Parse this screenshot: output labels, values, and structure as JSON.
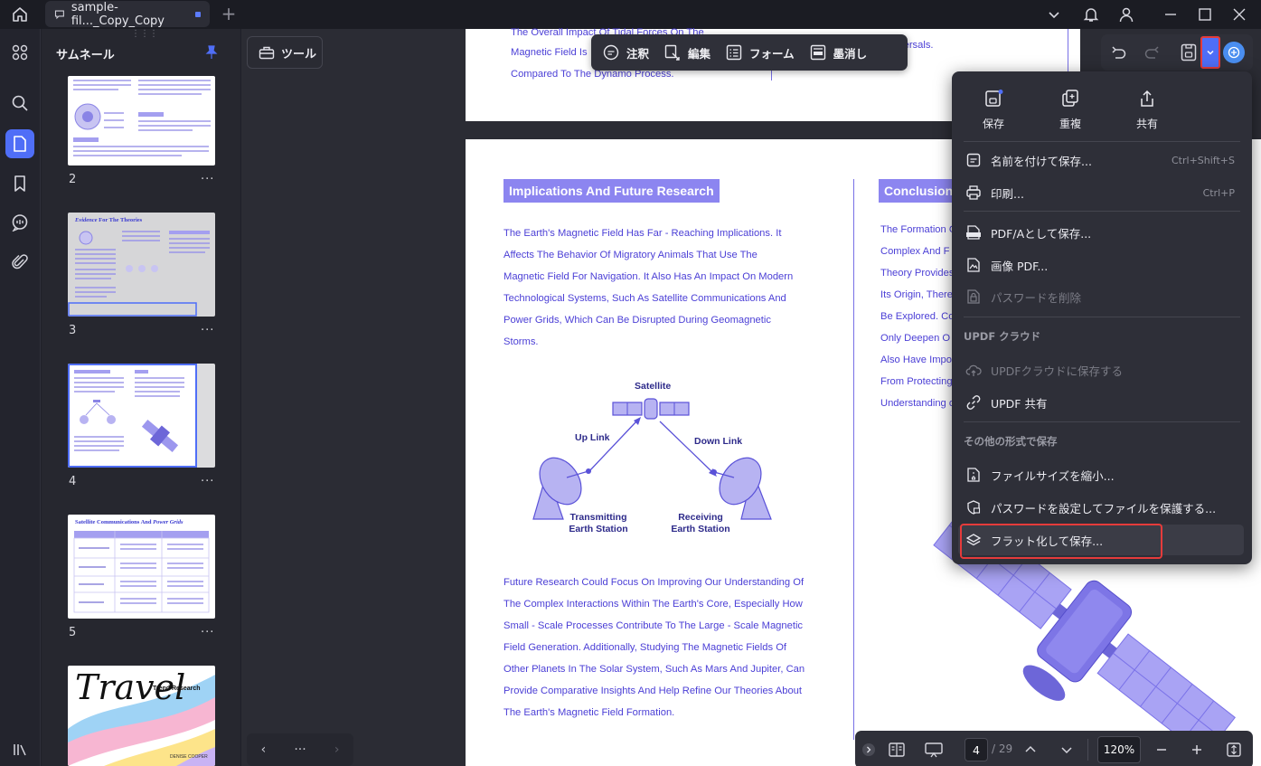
{
  "titlebar": {
    "tab_label": "sample-fil..._Copy_Copy",
    "add_tab": "+"
  },
  "thumbnails": {
    "title": "サムネール",
    "pages": [
      {
        "number": "2",
        "more": "···"
      },
      {
        "number": "3",
        "more": "···",
        "heading_prefix": "Evidence",
        "heading_suffix": " For The Theories"
      },
      {
        "number": "4",
        "more": "···"
      },
      {
        "number": "5",
        "more": "···",
        "heading_prefix": "Satellite Communications And ",
        "heading_suffix": "Power Grids"
      },
      {
        "title": "Travel",
        "subtitle": "Trend Research",
        "author": "DENISE COOPER"
      }
    ]
  },
  "toolbar": {
    "tools_label": "ツール",
    "modes": [
      {
        "label": "注釈",
        "icon": "comment-icon"
      },
      {
        "label": "編集",
        "icon": "edit-icon"
      },
      {
        "label": "フォーム",
        "icon": "form-icon"
      },
      {
        "label": "墨消し",
        "icon": "redact-icon"
      }
    ]
  },
  "document": {
    "top_left_lines": [
      "The Overall Impact Of Tidal Forces On The",
      "Magnetic Field Is",
      "Compared To The Dynamo Process."
    ],
    "top_right_text": "versals.",
    "left_heading": "Implications And Future Research",
    "right_heading": "Conclusion",
    "left_para1": [
      "The Earth's Magnetic Field Has Far - Reaching Implications. It",
      "Affects The Behavior Of Migratory Animals That Use The",
      "Magnetic Field For Navigation. It Also Has An Impact On Modern",
      "Technological Systems, Such As Satellite Communications And",
      "Power Grids, Which Can Be Disrupted During Geomagnetic",
      "Storms."
    ],
    "right_lines": [
      "The Formation O",
      "Complex And F",
      "Theory Provides",
      "Its Origin, There",
      "Be Explored. Co",
      "Only Deepen O",
      "Also Have Impo",
      "From Protecting",
      "Understanding o"
    ],
    "diagram": {
      "satellite": "Satellite",
      "uplink": "Up Link",
      "downlink": "Down Link",
      "tx_line1": "Transmitting",
      "tx_line2": "Earth Station",
      "rx_line1": "Receiving",
      "rx_line2": "Earth Station"
    },
    "left_para2": [
      "Future Research Could Focus On Improving Our Understanding Of",
      "The Complex Interactions Within The Earth's Core, Especially How",
      "Small - Scale Processes Contribute To The Large - Scale Magnetic",
      "Field Generation. Additionally, Studying The Magnetic Fields Of",
      "Other Planets In The Solar System, Such As Mars And Jupiter, Can",
      "Provide Comparative Insights And Help Refine Our Theories About",
      "The Earth's Magnetic Field Formation."
    ]
  },
  "menu": {
    "top_buttons": [
      {
        "label": "保存",
        "icon": "save-icon"
      },
      {
        "label": "重複",
        "icon": "duplicate-icon"
      },
      {
        "label": "共有",
        "icon": "share-icon"
      }
    ],
    "items": [
      {
        "label": "名前を付けて保存...",
        "shortcut": "Ctrl+Shift+S",
        "icon": "save-as-icon"
      },
      {
        "label": "印刷...",
        "shortcut": "Ctrl+P",
        "icon": "print-icon"
      },
      {
        "label": "PDF/Aとして保存...",
        "icon": "pdfa-icon"
      },
      {
        "label": "画像 PDF...",
        "icon": "image-pdf-icon"
      },
      {
        "label": "パスワードを削除",
        "icon": "remove-password-icon"
      }
    ],
    "cloud_section": "UPDF クラウド",
    "cloud_items": [
      {
        "label": "UPDFクラウドに保存する",
        "icon": "cloud-upload-icon"
      },
      {
        "label": "UPDF 共有",
        "icon": "link-icon"
      }
    ],
    "other_section": "その他の形式で保存",
    "other_items": [
      {
        "label": "ファイルサイズを縮小...",
        "icon": "compress-icon"
      },
      {
        "label": "パスワードを設定してファイルを保護する...",
        "icon": "protect-icon"
      },
      {
        "label": "フラット化して保存...",
        "icon": "flatten-icon"
      }
    ]
  },
  "pager": {
    "current_page": "4",
    "total_pages": "/ 29",
    "zoom": "120%",
    "dots": "···"
  },
  "colors": {
    "accent": "#4f6ef7",
    "highlight_red": "#e53b3b",
    "doc_text": "#4b3fd6",
    "heading_bg": "#8c85f0"
  }
}
